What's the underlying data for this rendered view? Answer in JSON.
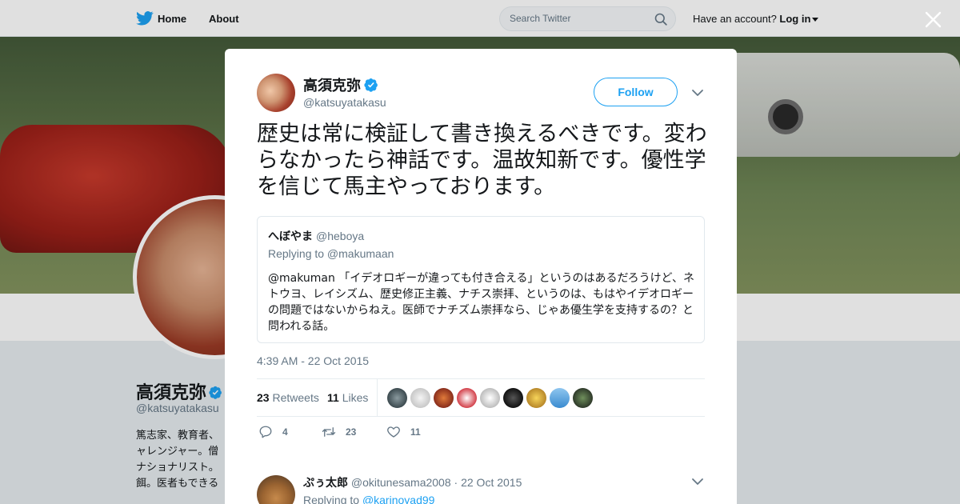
{
  "nav": {
    "home_label": "Home",
    "about_label": "About",
    "search_placeholder": "Search Twitter",
    "have_account": "Have an account?",
    "login_label": "Log in"
  },
  "profile": {
    "name": "高須克弥",
    "handle": "@katsuyatakasu",
    "bio": "篤志家、教育者、ャレンジャー。僧ナショナリスト。餌。医者もできる"
  },
  "tweet": {
    "author_name": "高須克弥",
    "author_handle": "@katsuyatakasu",
    "follow_label": "Follow",
    "text": "歴史は常に検証して書き換えるべきです。変わらなかったら神話です。温故知新です。優性学を信じて馬主やっております。",
    "timestamp": "4:39 AM - 22 Oct 2015",
    "retweets_count": "23",
    "retweets_label": "Retweets",
    "likes_count": "11",
    "likes_label": "Likes",
    "reply_count": "4",
    "retweet_action_count": "23",
    "like_action_count": "11",
    "likers": [
      "liker-1",
      "liker-2",
      "liker-3",
      "liker-4",
      "liker-5",
      "liker-6",
      "liker-7",
      "liker-8",
      "liker-9"
    ]
  },
  "quoted": {
    "name": "へぼやま",
    "handle": "@heboya",
    "replying_to": "Replying to @makumaan",
    "text": "@makuman 「イデオロギーが違っても付き合える」というのはあるだろうけど、ネトウヨ、レイシズム、歴史修正主義、ナチス崇拝、というのは、もはやイデオロギーの問題ではないからねえ。医師でナチズム崇拝なら、じゃあ優生学を支持するの？と問われる話。"
  },
  "reply": {
    "name": "ぷぅ太郎",
    "handle": "@okitunesama2008",
    "separator": "·",
    "date": "22 Oct 2015",
    "replying_prefix": "Replying to",
    "replying_to": "@karinoyad99"
  },
  "colors": {
    "accent": "#1da1f2",
    "text": "#14171a",
    "muted": "#657786"
  }
}
